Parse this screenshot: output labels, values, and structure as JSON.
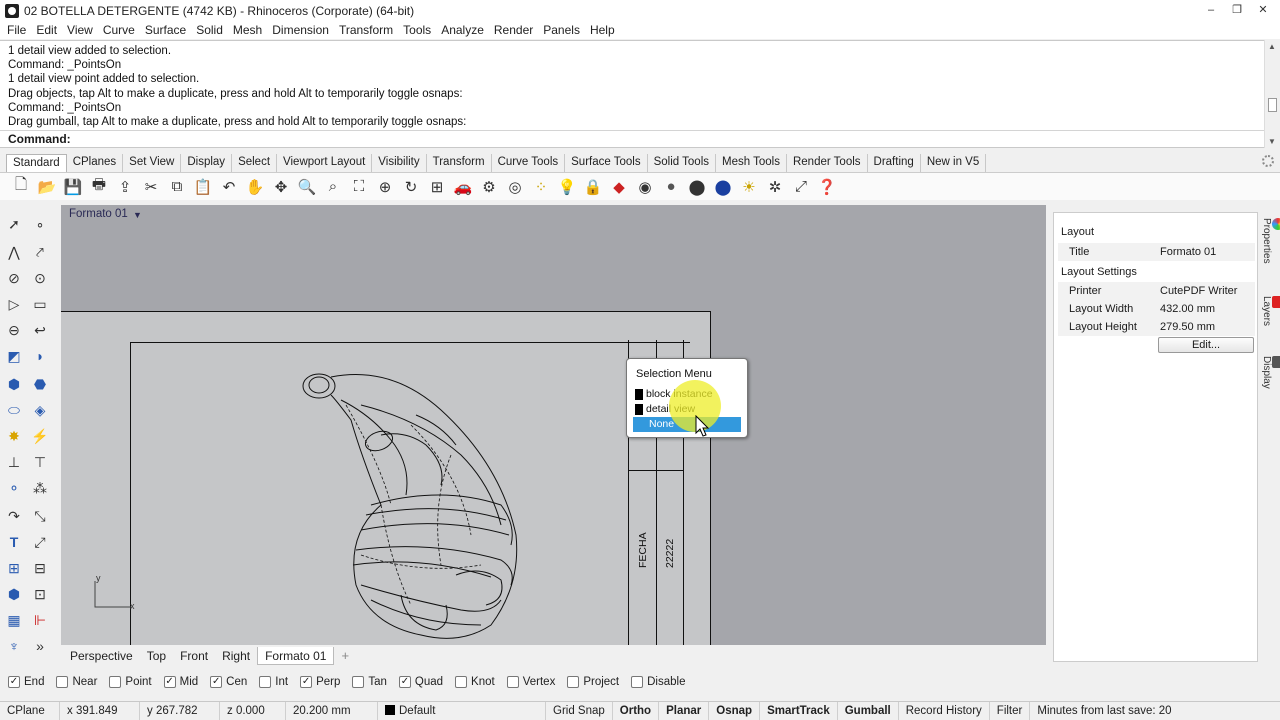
{
  "window": {
    "title": "02 BOTELLA DETERGENTE (4742 KB) - Rhinoceros (Corporate) (64-bit)",
    "minimize": "–",
    "restore": "❐",
    "close": "✕"
  },
  "menu": [
    "File",
    "Edit",
    "View",
    "Curve",
    "Surface",
    "Solid",
    "Mesh",
    "Dimension",
    "Transform",
    "Tools",
    "Analyze",
    "Render",
    "Panels",
    "Help"
  ],
  "history": [
    "1 detail view added to selection.",
    "Command: _PointsOn",
    "1 detail view point added to selection.",
    "Drag objects, tap Alt to make a duplicate, press and hold Alt to temporarily toggle osnaps:",
    "Command: _PointsOn",
    "Drag gumball, tap Alt to make a duplicate, press and hold Alt to temporarily toggle osnaps:"
  ],
  "command_prompt": "Command:",
  "toolbar_tabs": [
    "Standard",
    "CPlanes",
    "Set View",
    "Display",
    "Select",
    "Viewport Layout",
    "Visibility",
    "Transform",
    "Curve Tools",
    "Surface Tools",
    "Solid Tools",
    "Mesh Tools",
    "Render Tools",
    "Drafting",
    "New in V5"
  ],
  "toolbar_icons": [
    "new-icon",
    "open-icon",
    "save-icon",
    "print-icon",
    "import-icon",
    "cut-icon",
    "copy-icon",
    "paste-icon",
    "undo-icon",
    "pan-hand-icon",
    "move-icon",
    "zoom-icon",
    "zoom-window-icon",
    "zoom-extents-icon",
    "zoom-selected-icon",
    "rotate-view-icon",
    "four-viewports-icon",
    "car-icon",
    "options-icon",
    "display-icon",
    "select-points-icon",
    "light-icon",
    "lock-icon",
    "layer-icon",
    "color-wheel-icon",
    "shaded-icon",
    "rendered-icon",
    "render-icon",
    "sun-icon",
    "gear-icon",
    "dimension-icon",
    "help-icon"
  ],
  "viewport": {
    "title": "Formato 01",
    "titleblock_label": "FECHA",
    "titleblock_value": "22222",
    "axis_y": "y",
    "axis_x": "x"
  },
  "selection_menu": {
    "title": "Selection Menu",
    "items": [
      "block instance",
      "detail view",
      "None"
    ],
    "selected": "None"
  },
  "viewport_tabs": [
    "Perspective",
    "Top",
    "Front",
    "Right",
    "Formato 01",
    "+"
  ],
  "properties": {
    "section_layout": "Layout",
    "title_label": "Title",
    "title_value": "Formato 01",
    "section_settings": "Layout Settings",
    "printer_label": "Printer",
    "printer_value": "CutePDF Writer",
    "width_label": "Layout Width",
    "width_value": "432.00 mm",
    "height_label": "Layout Height",
    "height_value": "279.50 mm",
    "edit_button": "Edit..."
  },
  "side_tabs": [
    "Properties",
    "Layers",
    "Display"
  ],
  "osnaps": [
    {
      "label": "End",
      "checked": true
    },
    {
      "label": "Near",
      "checked": false
    },
    {
      "label": "Point",
      "checked": false
    },
    {
      "label": "Mid",
      "checked": true
    },
    {
      "label": "Cen",
      "checked": true
    },
    {
      "label": "Int",
      "checked": false
    },
    {
      "label": "Perp",
      "checked": true
    },
    {
      "label": "Tan",
      "checked": false
    },
    {
      "label": "Quad",
      "checked": true
    },
    {
      "label": "Knot",
      "checked": false
    },
    {
      "label": "Vertex",
      "checked": false
    },
    {
      "label": "Project",
      "checked": false
    },
    {
      "label": "Disable",
      "checked": false
    }
  ],
  "status": {
    "cplane": "CPlane",
    "x": "x 391.849",
    "y": "y 267.782",
    "z": "z 0.000",
    "dist": "20.200 mm",
    "layer": "Default",
    "grid_snap": "Grid Snap",
    "ortho": "Ortho",
    "planar": "Planar",
    "osnap": "Osnap",
    "smarttrack": "SmartTrack",
    "gumball": "Gumball",
    "record_history": "Record History",
    "filter": "Filter",
    "save_info": "Minutes from last save: 20"
  },
  "colors": {
    "viewport_bg": "#a5a6ab",
    "selection_highlight": "#3399dd",
    "cursor_halo": "#eeee28"
  }
}
